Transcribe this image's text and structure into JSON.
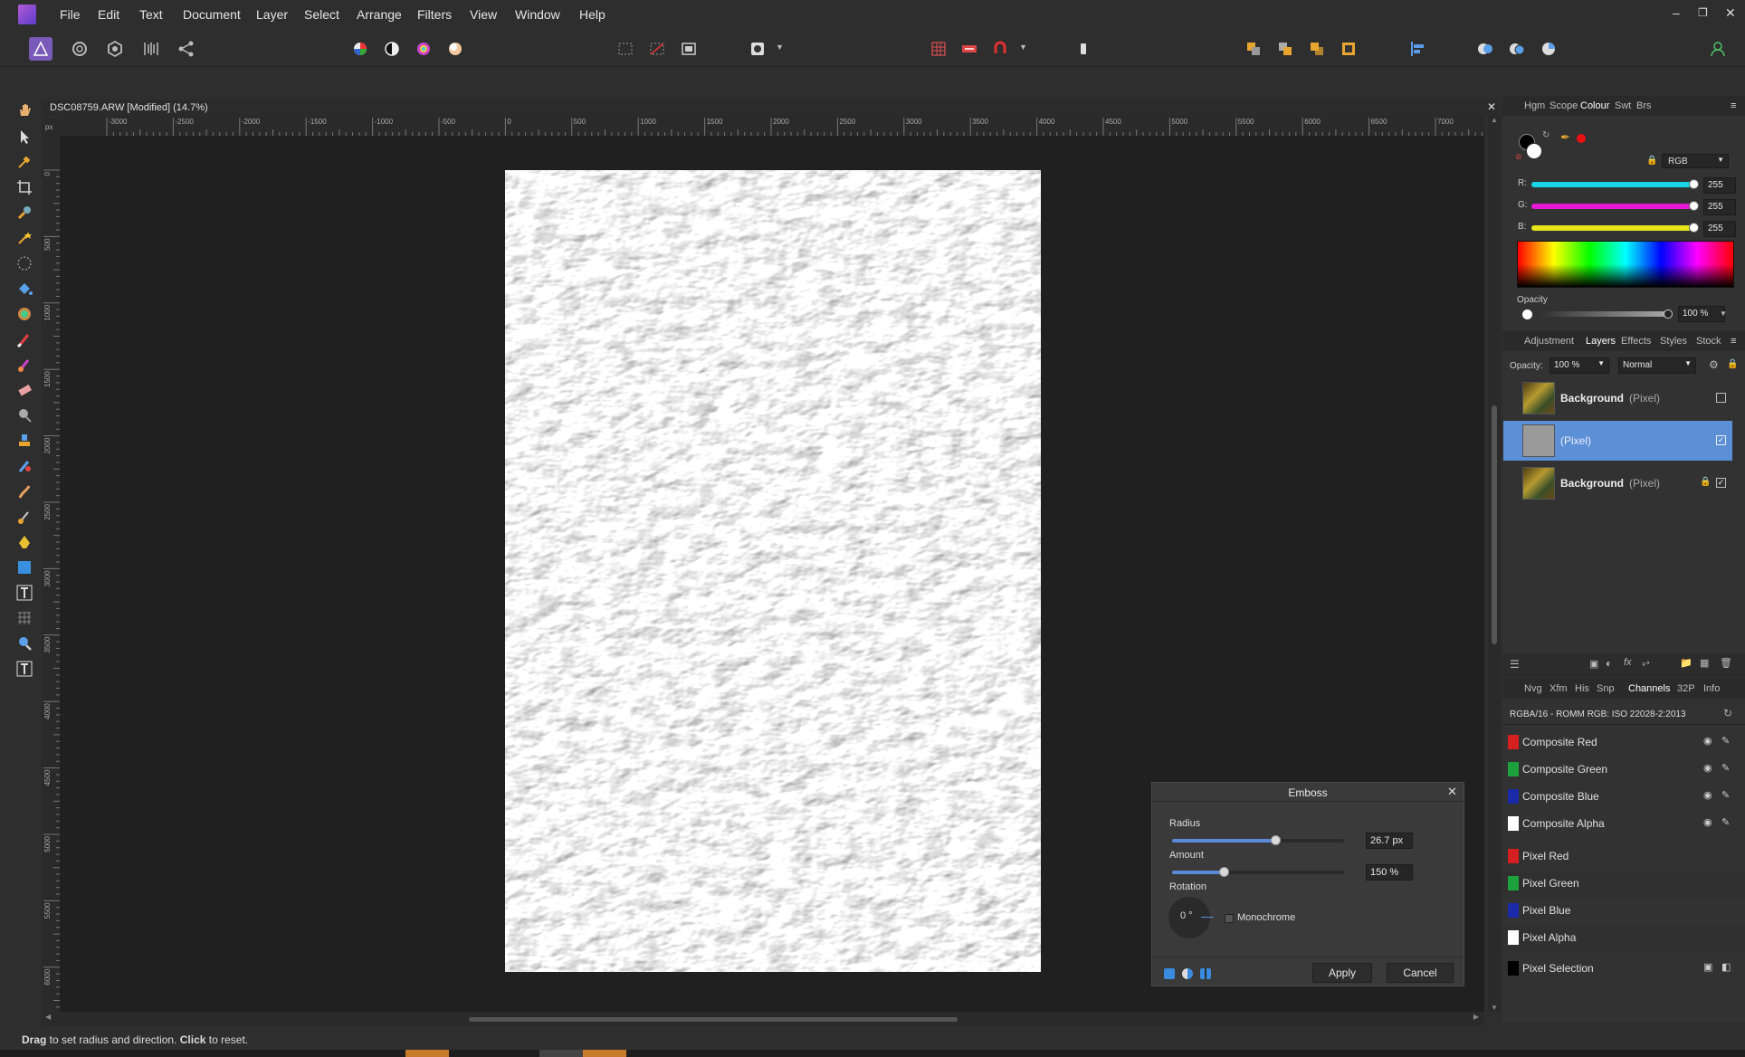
{
  "menubar": {
    "items": [
      "File",
      "Edit",
      "Text",
      "Document",
      "Layer",
      "Select",
      "Arrange",
      "Filters",
      "View",
      "Window",
      "Help"
    ]
  },
  "document": {
    "title": "DSC08759.ARW [Modified] (14.7%)",
    "ruler_unit": "px",
    "h_ruler_labels": [
      "-3000",
      "-2500",
      "-2000",
      "-1500",
      "-1000",
      "-500",
      "0",
      "500",
      "1000",
      "1500",
      "2000",
      "2500",
      "3000",
      "3500",
      "4000",
      "4500",
      "5000",
      "5500",
      "6000",
      "6500",
      "7000"
    ],
    "v_ruler_labels": [
      "0",
      "500",
      "1000",
      "1500",
      "2000",
      "2500",
      "3000",
      "3500",
      "4000",
      "4500",
      "5000",
      "5500",
      "6000"
    ]
  },
  "colour_panel": {
    "tabs": [
      "Hgm",
      "Scope",
      "Colour",
      "Swt",
      "Brs"
    ],
    "active_tab": "Colour",
    "model": "RGB",
    "r_label": "R:",
    "r_value": "255",
    "g_label": "G:",
    "g_value": "255",
    "b_label": "B:",
    "b_value": "255",
    "opacity_label": "Opacity",
    "opacity_value": "100 %"
  },
  "layers_panel": {
    "tabs": [
      "Adjustment",
      "Layers",
      "Effects",
      "Styles",
      "Stock"
    ],
    "active_tab": "Layers",
    "opacity_label": "Opacity:",
    "opacity_value": "100 %",
    "blend_mode": "Normal",
    "layers": [
      {
        "name": "Background",
        "type": "(Pixel)",
        "selected": false,
        "locked": false,
        "visible": false
      },
      {
        "name": "",
        "type": "(Pixel)",
        "selected": true,
        "locked": false,
        "visible": true
      },
      {
        "name": "Background",
        "type": "(Pixel)",
        "selected": false,
        "locked": true,
        "visible": true
      }
    ]
  },
  "channels_panel": {
    "tabs": [
      "Nvg",
      "Xfm",
      "His",
      "Snp",
      "Channels",
      "32P",
      "Info"
    ],
    "active_tab": "Channels",
    "profile": "RGBA/16 - ROMM RGB: ISO 22028-2:2013",
    "channels": [
      {
        "name": "Composite Red",
        "color": "#d42020"
      },
      {
        "name": "Composite Green",
        "color": "#1ea03c"
      },
      {
        "name": "Composite Blue",
        "color": "#1a2aa8"
      },
      {
        "name": "Composite Alpha",
        "color": "#ffffff"
      },
      {
        "name": "Pixel Red",
        "color": "#d42020"
      },
      {
        "name": "Pixel Green",
        "color": "#1ea03c"
      },
      {
        "name": "Pixel Blue",
        "color": "#1a2aa8"
      },
      {
        "name": "Pixel Alpha",
        "color": "#ffffff"
      },
      {
        "name": "Pixel Selection",
        "color": "#000000"
      }
    ]
  },
  "emboss_dialog": {
    "title": "Emboss",
    "radius_label": "Radius",
    "radius_value": "26.7 px",
    "radius_fraction": 0.6,
    "amount_label": "Amount",
    "amount_value": "150 %",
    "amount_fraction": 0.3,
    "rotation_label": "Rotation",
    "rotation_value": "0 °",
    "monochrome_label": "Monochrome",
    "apply_label": "Apply",
    "cancel_label": "Cancel"
  },
  "status": {
    "bold1": "Drag",
    "text1": " to set radius and direction. ",
    "bold2": "Click",
    "text2": " to reset."
  },
  "colors": {
    "accent": "#5a8ad8",
    "selected_layer": "#5b8fd6",
    "r_slider": "#19d4e6",
    "g_slider": "#e619d4",
    "b_slider": "#e6e619"
  }
}
